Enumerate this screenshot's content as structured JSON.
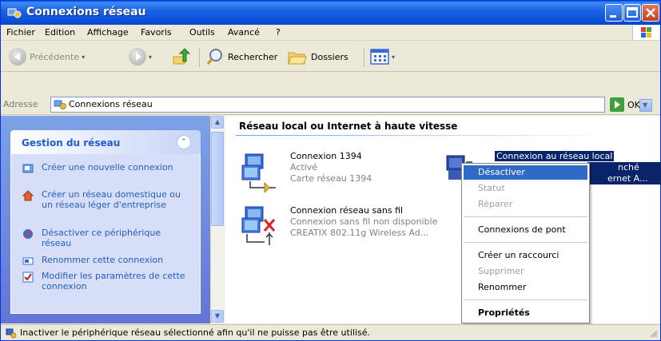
{
  "window": {
    "title": "Connexions réseau"
  },
  "menubar": {
    "items": [
      "Fichier",
      "Edition",
      "Affichage",
      "Favoris",
      "Outils",
      "Avancé",
      "?"
    ]
  },
  "toolbar": {
    "back_label": "Précédente",
    "search_label": "Rechercher",
    "folders_label": "Dossiers"
  },
  "address": {
    "label": "Adresse",
    "value": "Connexions réseau",
    "go_label": "OK"
  },
  "taskpane": {
    "title": "Gestion du réseau",
    "tasks": [
      {
        "label": "Créer une nouvelle connexion",
        "icon": "new-connection-icon"
      },
      {
        "label": "Créer un réseau domestique ou un réseau léger d'entreprise",
        "icon": "home-network-icon"
      },
      {
        "label": "Désactiver ce périphérique réseau",
        "icon": "disable-device-icon"
      },
      {
        "label": "Renommer cette connexion",
        "icon": "rename-icon"
      },
      {
        "label": "Modifier les paramètres de cette connexion",
        "icon": "settings-check-icon"
      }
    ]
  },
  "content": {
    "group_title": "Réseau local ou Internet à haute vitesse",
    "connections": [
      {
        "name": "Connexion 1394",
        "status": "Activé",
        "device": "Carte réseau 1394",
        "icon": "firewire-connection-icon"
      },
      {
        "name": "Connexion réseau sans fil",
        "status": "Connexion sans fil non disponible",
        "device": "CREATIX 802.11g Wireless Ad...",
        "icon": "wireless-connection-icon"
      },
      {
        "name": "Connexion au réseau local",
        "status_partial": "nché",
        "device_partial": "ernet A...",
        "icon": "lan-connection-icon"
      }
    ]
  },
  "context_menu": {
    "items": [
      {
        "label": "Désactiver",
        "state": "highlighted"
      },
      {
        "label": "Statut",
        "state": "disabled"
      },
      {
        "label": "Réparer",
        "state": "disabled"
      },
      {
        "label": "Connexions de pont",
        "state": "normal"
      },
      {
        "label": "Créer un raccourci",
        "state": "normal"
      },
      {
        "label": "Supprimer",
        "state": "disabled"
      },
      {
        "label": "Renommer",
        "state": "normal"
      },
      {
        "label": "Propriétés",
        "state": "bold"
      }
    ]
  },
  "statusbar": {
    "text": "Inactiver le périphérique réseau sélectionné afin qu'il ne puisse pas être utilisé."
  },
  "colors": {
    "titlebar": "#0b4fd8",
    "selection": "#0a246a",
    "menu_highlight": "#316ac5",
    "task_link": "#215dc6"
  }
}
